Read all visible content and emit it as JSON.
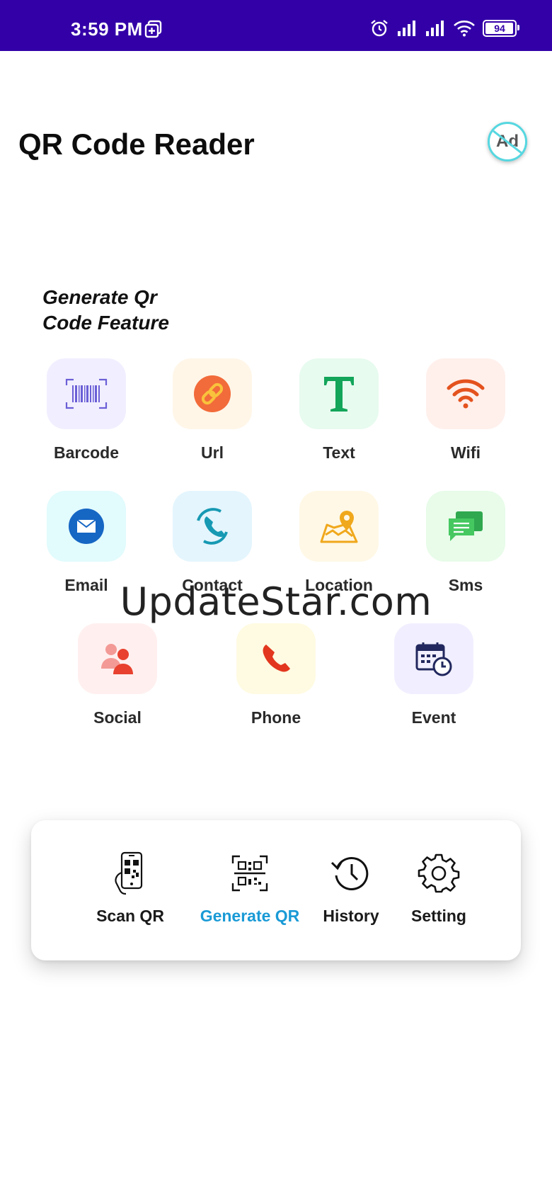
{
  "status_bar": {
    "time": "3:59 PM",
    "battery": "94"
  },
  "header": {
    "title": "QR Code Reader",
    "ad_label": "Ad"
  },
  "section": {
    "title": "Generate Qr Code Feature"
  },
  "features": [
    {
      "label": "Barcode",
      "icon": "barcode-icon",
      "bg": "#f1efff"
    },
    {
      "label": "Url",
      "icon": "link-icon",
      "bg": "#fff6e8"
    },
    {
      "label": "Text",
      "icon": "text-icon",
      "bg": "#e7fbef"
    },
    {
      "label": "Wifi",
      "icon": "wifi-icon",
      "bg": "#fff0ec"
    },
    {
      "label": "Email",
      "icon": "email-icon",
      "bg": "#e2fbfd"
    },
    {
      "label": "Contact",
      "icon": "contact-phone-icon",
      "bg": "#e4f5fd"
    },
    {
      "label": "Location",
      "icon": "map-location-icon",
      "bg": "#fff8e6"
    },
    {
      "label": "Sms",
      "icon": "sms-icon",
      "bg": "#e8fce9"
    },
    {
      "label": "Social",
      "icon": "social-people-icon",
      "bg": "#fff0ef"
    },
    {
      "label": "Phone",
      "icon": "phone-icon",
      "bg": "#fffbe2"
    },
    {
      "label": "Event",
      "icon": "calendar-event-icon",
      "bg": "#f1efff"
    }
  ],
  "watermark": "UpdateStar.com",
  "nav": {
    "scan": "Scan QR",
    "generate": "Generate QR",
    "history": "History",
    "setting": "Setting",
    "active": "generate",
    "active_color": "#1a9ad6"
  },
  "colors": {
    "status_bar": "#3300a8",
    "ad_ring": "#56d7e0"
  }
}
